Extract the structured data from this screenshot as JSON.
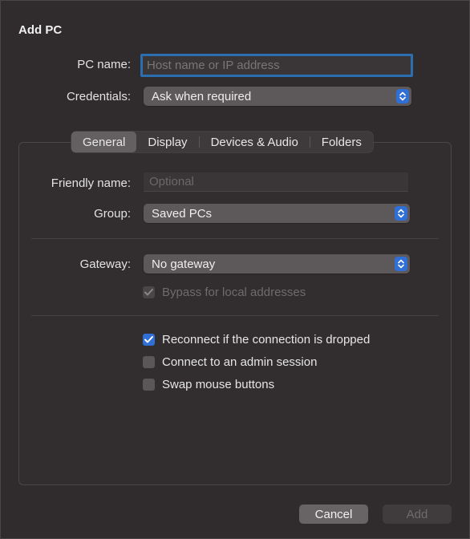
{
  "window": {
    "title": "Add PC"
  },
  "fields": {
    "pc_name_label": "PC name:",
    "pc_name_placeholder": "Host name or IP address",
    "pc_name_value": "",
    "credentials_label": "Credentials:",
    "credentials_value": "Ask when required"
  },
  "tabs": [
    {
      "label": "General",
      "active": true
    },
    {
      "label": "Display",
      "active": false
    },
    {
      "label": "Devices & Audio",
      "active": false
    },
    {
      "label": "Folders",
      "active": false
    }
  ],
  "general": {
    "friendly_name_label": "Friendly name:",
    "friendly_name_placeholder": "Optional",
    "group_label": "Group:",
    "group_value": "Saved PCs",
    "gateway_label": "Gateway:",
    "gateway_value": "No gateway",
    "bypass_label": "Bypass for local addresses",
    "bypass_checked": true,
    "bypass_disabled": true,
    "options": [
      {
        "label": "Reconnect if the connection is dropped",
        "checked": true
      },
      {
        "label": "Connect to an admin session",
        "checked": false
      },
      {
        "label": "Swap mouse buttons",
        "checked": false
      }
    ]
  },
  "buttons": {
    "cancel": "Cancel",
    "add": "Add"
  },
  "colors": {
    "accent": "#2f6fd6",
    "focus_ring": "#2b6fb1",
    "window_bg": "#302b2c"
  },
  "icons": {
    "popup_chevron": "chevron-up-down-icon",
    "checkmark": "checkmark-icon"
  }
}
